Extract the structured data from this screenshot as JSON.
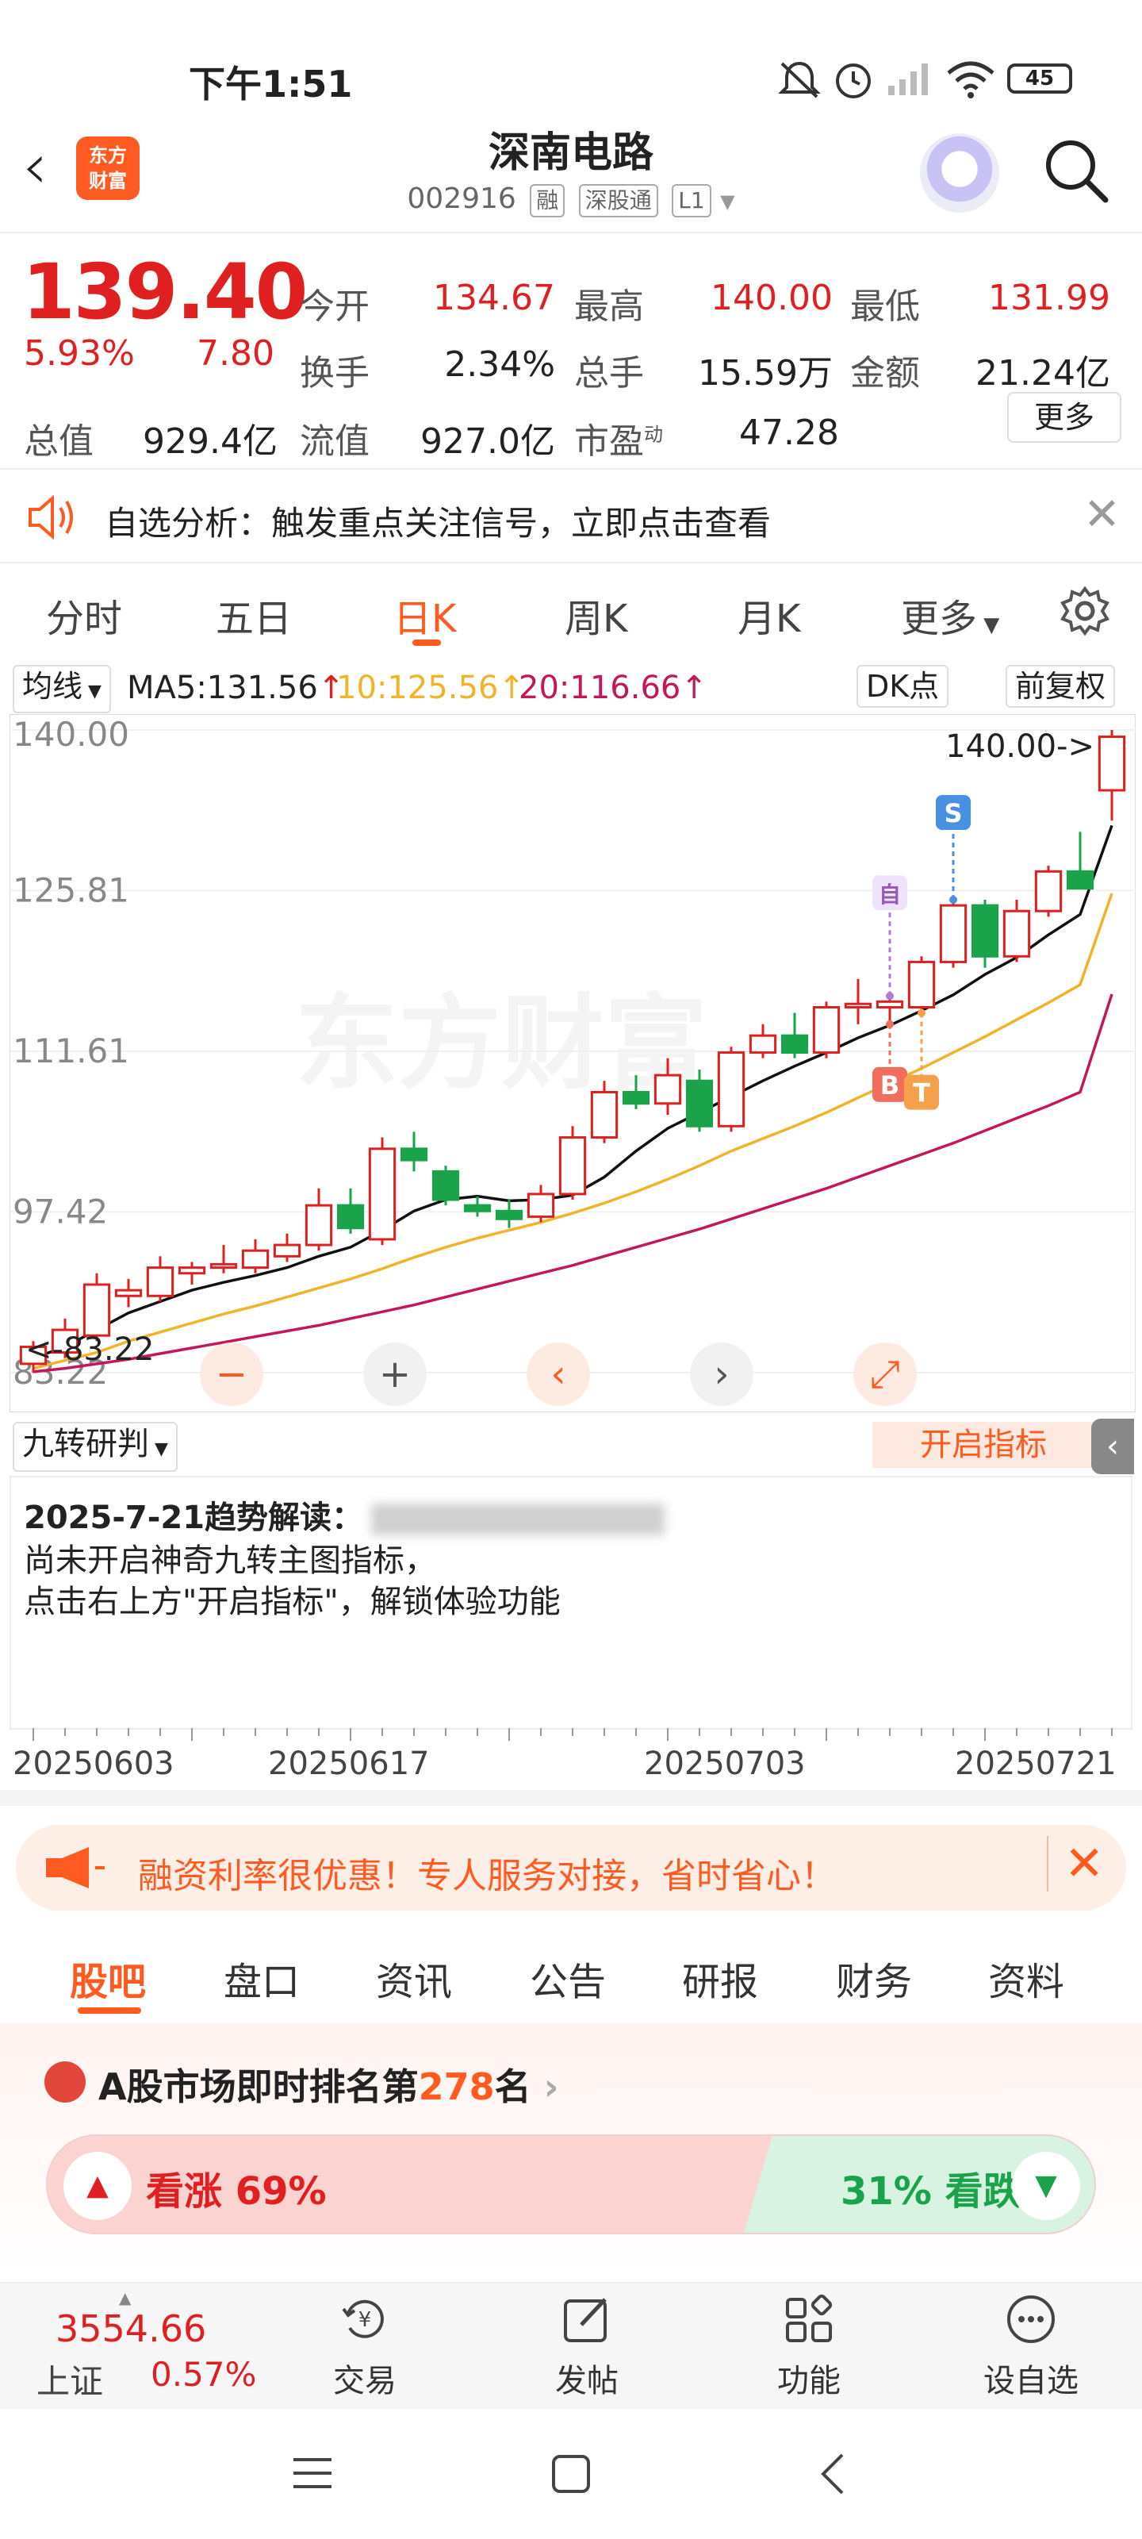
{
  "status": {
    "time": "下午1:51",
    "battery": "45"
  },
  "header": {
    "logo_line1": "东方",
    "logo_line2": "财富",
    "name": "深南电路",
    "code": "002916",
    "tags": [
      "融",
      "深股通",
      "L1"
    ]
  },
  "quote": {
    "price": "139.40",
    "change_pct": "5.93%",
    "change_val": "7.80",
    "fields": [
      {
        "label": "今开",
        "value": "134.67",
        "color": "#e02020"
      },
      {
        "label": "最高",
        "value": "140.00",
        "color": "#e02020"
      },
      {
        "label": "最低",
        "value": "131.99",
        "color": "#e02020"
      },
      {
        "label": "换手",
        "value": "2.34%",
        "color": "#222"
      },
      {
        "label": "总手",
        "value": "15.59万",
        "color": "#222"
      },
      {
        "label": "金额",
        "value": "21.24亿",
        "color": "#222"
      },
      {
        "label": "总值",
        "value": "929.4亿",
        "color": "#222"
      },
      {
        "label": "流值",
        "value": "927.0亿",
        "color": "#222"
      },
      {
        "label": "市盈",
        "value": "47.28",
        "color": "#222"
      }
    ],
    "pe_superscript": "动",
    "more": "更多"
  },
  "analysis": {
    "text": "自选分析：触发重点关注信号，立即点击查看"
  },
  "period_tabs": [
    "分时",
    "五日",
    "日K",
    "周K",
    "月K",
    "更多"
  ],
  "ma": {
    "selector": "均线",
    "ma5": "MA5:131.56",
    "ma10": "10:125.56",
    "ma20": "20:116.66",
    "dk": "DK点",
    "adjust": "前复权",
    "ma5_color": "#111111",
    "ma10_color": "#f0b429",
    "ma20_color": "#c2185b"
  },
  "chart_data": {
    "type": "candlestick",
    "price_ticks": [
      "140.00",
      "125.81",
      "111.61",
      "97.42",
      "83.22"
    ],
    "high_label": "140.00->",
    "low_label": "<-83.22",
    "ylim": [
      83.22,
      140.0
    ],
    "dates": [
      "20250603",
      "20250617",
      "20250703",
      "20250721"
    ],
    "up_color": "#e02020",
    "down_color": "#1aa34a",
    "candles": [
      {
        "o": 84.0,
        "h": 86.0,
        "l": 83.22,
        "c": 85.5
      },
      {
        "o": 85.0,
        "h": 88.0,
        "l": 84.5,
        "c": 87.0
      },
      {
        "o": 86.5,
        "h": 92.0,
        "l": 86.0,
        "c": 91.0
      },
      {
        "o": 90.0,
        "h": 91.5,
        "l": 89.0,
        "c": 90.5
      },
      {
        "o": 90.0,
        "h": 93.5,
        "l": 89.5,
        "c": 92.5
      },
      {
        "o": 92.0,
        "h": 93.0,
        "l": 91.0,
        "c": 92.5
      },
      {
        "o": 92.5,
        "h": 94.5,
        "l": 92.0,
        "c": 92.8
      },
      {
        "o": 92.5,
        "h": 95.0,
        "l": 92.0,
        "c": 94.0
      },
      {
        "o": 93.5,
        "h": 95.5,
        "l": 93.0,
        "c": 94.5
      },
      {
        "o": 94.5,
        "h": 99.5,
        "l": 94.0,
        "c": 98.0
      },
      {
        "o": 98.0,
        "h": 99.5,
        "l": 95.5,
        "c": 96.0
      },
      {
        "o": 95.0,
        "h": 104.0,
        "l": 94.5,
        "c": 103.0
      },
      {
        "o": 103.0,
        "h": 104.5,
        "l": 101.0,
        "c": 102.0
      },
      {
        "o": 101.0,
        "h": 101.5,
        "l": 98.0,
        "c": 98.5
      },
      {
        "o": 98.0,
        "h": 98.8,
        "l": 97.0,
        "c": 97.5
      },
      {
        "o": 97.5,
        "h": 98.5,
        "l": 96.0,
        "c": 96.8
      },
      {
        "o": 97.0,
        "h": 99.8,
        "l": 96.5,
        "c": 99.0
      },
      {
        "o": 99.0,
        "h": 105.0,
        "l": 98.5,
        "c": 104.0
      },
      {
        "o": 104.0,
        "h": 109.0,
        "l": 103.5,
        "c": 108.0
      },
      {
        "o": 108.0,
        "h": 109.5,
        "l": 106.5,
        "c": 107.0
      },
      {
        "o": 107.0,
        "h": 111.0,
        "l": 106.0,
        "c": 109.5
      },
      {
        "o": 109.0,
        "h": 110.0,
        "l": 104.5,
        "c": 105.0
      },
      {
        "o": 105.0,
        "h": 112.0,
        "l": 104.5,
        "c": 111.5
      },
      {
        "o": 111.5,
        "h": 114.0,
        "l": 111.0,
        "c": 113.0
      },
      {
        "o": 113.0,
        "h": 115.0,
        "l": 111.0,
        "c": 111.5
      },
      {
        "o": 111.5,
        "h": 116.0,
        "l": 111.0,
        "c": 115.5
      },
      {
        "o": 115.5,
        "h": 118.0,
        "l": 114.0,
        "c": 115.8
      },
      {
        "o": 115.5,
        "h": 116.5,
        "l": 114.0,
        "c": 116.0
      },
      {
        "o": 115.5,
        "h": 120.0,
        "l": 115.0,
        "c": 119.5
      },
      {
        "o": 119.5,
        "h": 125.0,
        "l": 119.0,
        "c": 124.5
      },
      {
        "o": 124.5,
        "h": 125.0,
        "l": 119.0,
        "c": 120.0
      },
      {
        "o": 120.0,
        "h": 125.0,
        "l": 119.5,
        "c": 124.0
      },
      {
        "o": 124.0,
        "h": 128.0,
        "l": 123.5,
        "c": 127.5
      },
      {
        "o": 127.5,
        "h": 131.0,
        "l": 126.0,
        "c": 126.0
      },
      {
        "o": 134.67,
        "h": 140.0,
        "l": 131.99,
        "c": 139.4
      }
    ],
    "ma5": [
      84.5,
      85.5,
      87.0,
      88.5,
      89.5,
      90.5,
      91.2,
      91.8,
      92.5,
      93.5,
      94.3,
      95.8,
      97.5,
      98.5,
      98.8,
      98.4,
      98.5,
      98.9,
      100.5,
      102.8,
      104.8,
      106.2,
      107.6,
      109.0,
      110.3,
      111.5,
      112.8,
      113.9,
      115.2,
      116.6,
      118.4,
      119.9,
      121.9,
      123.7,
      131.56
    ],
    "ma10": [
      83.6,
      84.3,
      85.0,
      86.0,
      86.8,
      87.6,
      88.4,
      89.1,
      89.9,
      90.7,
      91.5,
      92.4,
      93.4,
      94.3,
      95.1,
      95.8,
      96.5,
      97.3,
      98.2,
      99.2,
      100.3,
      101.5,
      102.8,
      103.9,
      105.0,
      106.2,
      107.5,
      108.8,
      110.1,
      111.5,
      112.9,
      114.4,
      115.9,
      117.5,
      125.56
    ],
    "ma20": [
      83.3,
      83.6,
      84.0,
      84.4,
      84.9,
      85.4,
      85.9,
      86.4,
      86.9,
      87.4,
      88.0,
      88.6,
      89.2,
      89.9,
      90.6,
      91.3,
      92.0,
      92.7,
      93.5,
      94.3,
      95.1,
      95.9,
      96.8,
      97.7,
      98.6,
      99.5,
      100.5,
      101.5,
      102.5,
      103.5,
      104.6,
      105.7,
      106.8,
      108.0,
      116.66
    ],
    "markers": {
      "zi": "自",
      "b": "B",
      "s": "S",
      "t": "T"
    },
    "watermark": "东方财富"
  },
  "indicator": {
    "selector": "九转研判",
    "open": "开启指标",
    "title": "2025-7-21趋势解读：",
    "line1": "尚未开启神奇九转主图指标，",
    "line2": "点击右上方\"开启指标\"，解锁体验功能"
  },
  "promo": {
    "text": "融资利率很优惠！专人服务对接，省时省心！"
  },
  "bottom_tabs": [
    "股吧",
    "盘口",
    "资讯",
    "公告",
    "研报",
    "财务",
    "资料"
  ],
  "rank": {
    "prefix": "A股市场即时排名第",
    "number": "278",
    "suffix": "名"
  },
  "vote": {
    "up": "看涨 69%",
    "down": "31% 看跌",
    "up_fraction": 0.69
  },
  "bottombar": {
    "index_value": "3554.66",
    "index_name": "上证",
    "index_pct": "0.57%",
    "items": [
      {
        "label": "交易",
        "icon": "yuan-refresh-icon"
      },
      {
        "label": "发帖",
        "icon": "edit-icon"
      },
      {
        "label": "功能",
        "icon": "grid-icon"
      },
      {
        "label": "设自选",
        "icon": "more-dots-icon"
      }
    ]
  }
}
